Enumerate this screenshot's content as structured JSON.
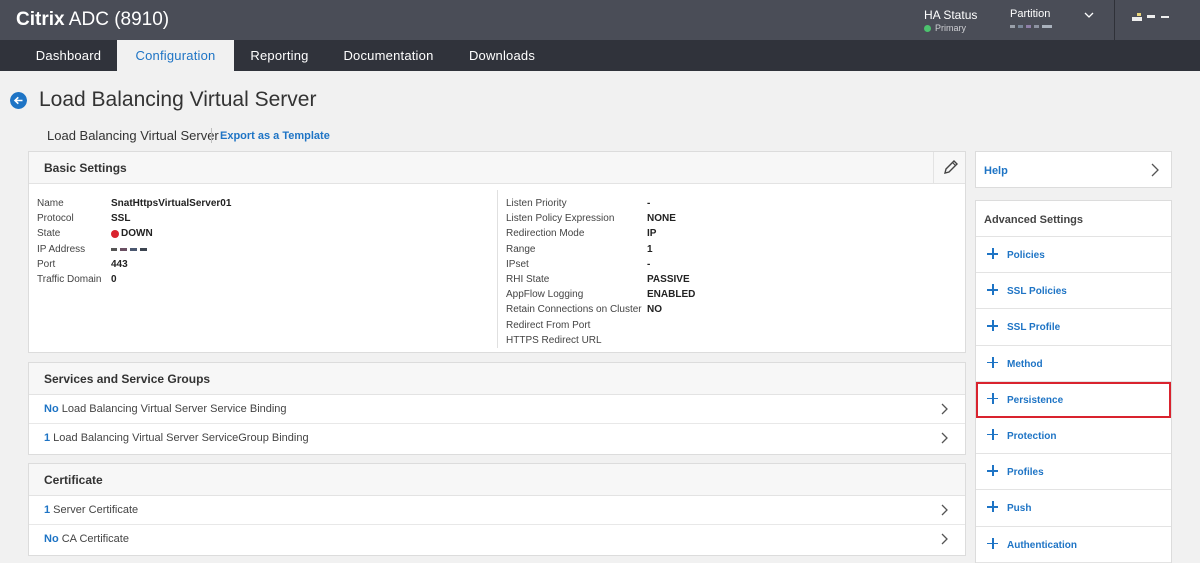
{
  "header": {
    "brand_bold": "Citrix",
    "brand_rest": " ADC (8910)",
    "ha_title": "HA Status",
    "ha_sub": "Primary",
    "partition_label": "Partition"
  },
  "nav": {
    "tabs": [
      {
        "label": "Dashboard"
      },
      {
        "label": "Configuration"
      },
      {
        "label": "Reporting"
      },
      {
        "label": "Documentation"
      },
      {
        "label": "Downloads"
      }
    ]
  },
  "page": {
    "title": "Load Balancing Virtual Server",
    "sub_label": "Load Balancing Virtual Server",
    "export_link": "Export as a Template"
  },
  "basic": {
    "title": "Basic Settings",
    "left": [
      {
        "k": "Name",
        "v": "SnatHttpsVirtualServer01"
      },
      {
        "k": "Protocol",
        "v": "SSL"
      },
      {
        "k": "State",
        "v": "DOWN"
      },
      {
        "k": "IP Address",
        "v": ""
      },
      {
        "k": "Port",
        "v": "443"
      },
      {
        "k": "Traffic Domain",
        "v": "0"
      }
    ],
    "right": [
      {
        "k": "Listen Priority",
        "v": "-"
      },
      {
        "k": "Listen Policy Expression",
        "v": "NONE"
      },
      {
        "k": "Redirection Mode",
        "v": "IP"
      },
      {
        "k": "Range",
        "v": "1"
      },
      {
        "k": "IPset",
        "v": "-"
      },
      {
        "k": "RHI State",
        "v": "PASSIVE"
      },
      {
        "k": "AppFlow Logging",
        "v": "ENABLED"
      },
      {
        "k": "Retain Connections on Cluster",
        "v": "NO"
      },
      {
        "k": "Redirect From Port",
        "v": ""
      },
      {
        "k": "HTTPS Redirect URL",
        "v": ""
      }
    ]
  },
  "services": {
    "title": "Services and Service Groups",
    "rows": [
      {
        "num": "No",
        "text": " Load Balancing Virtual Server Service Binding"
      },
      {
        "num": "1",
        "text": " Load Balancing Virtual Server ServiceGroup Binding"
      }
    ]
  },
  "certificate": {
    "title": "Certificate",
    "rows": [
      {
        "num": "1",
        "text": " Server Certificate"
      },
      {
        "num": "No",
        "text": " CA Certificate"
      }
    ]
  },
  "help": {
    "label": "Help"
  },
  "advanced": {
    "title": "Advanced Settings",
    "items": [
      {
        "label": "Policies"
      },
      {
        "label": "SSL Policies"
      },
      {
        "label": "SSL Profile"
      },
      {
        "label": "Method"
      },
      {
        "label": "Persistence"
      },
      {
        "label": "Protection"
      },
      {
        "label": "Profiles"
      },
      {
        "label": "Push"
      },
      {
        "label": "Authentication"
      }
    ]
  },
  "colors": {
    "accent": "#1e74c5",
    "topbar": "#4a4d57",
    "navbar": "#30333b",
    "state_down": "#d9232e",
    "highlight": "#d9232e"
  }
}
